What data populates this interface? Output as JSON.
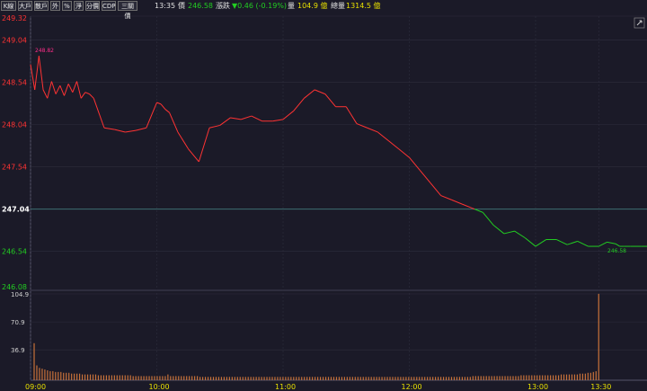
{
  "toolbar": {
    "buttons": [
      "K線",
      "大戶",
      "散戶",
      "外",
      "%",
      "淨",
      "分價",
      "CDP",
      "三關價"
    ],
    "time": "13:35",
    "price_label": "價",
    "price_value": "246.58",
    "change_label": "漲跌",
    "change_value": "▼0.46 (-0.19%)",
    "volume_label": "量",
    "volume_value": "104.9 億",
    "total_label": "總量",
    "total_value": "1314.5 億"
  },
  "colors": {
    "background": "#1b1a28",
    "up": "#ff3333",
    "down": "#22cc22",
    "reference": "#3c6e72",
    "volume": "#c8723a",
    "time_label": "#e8e000",
    "max_label": "#ff2d8a",
    "grid": "#2e2d3d"
  },
  "chart_data": [
    {
      "type": "line",
      "reference_price": 247.04,
      "ylim": [
        246.08,
        249.32
      ],
      "y_ticks": [
        "249.32",
        "249.04",
        "248.54",
        "248.04",
        "247.54",
        "247.04",
        "246.54",
        "246.08"
      ],
      "x_ticks": [
        "09:00",
        "10:00",
        "11:00",
        "12:00",
        "13:00",
        "13:30"
      ],
      "annotations": {
        "high": "248.82",
        "last": "246.58"
      },
      "x": [
        0,
        2,
        4,
        6,
        8,
        10,
        12,
        14,
        16,
        18,
        20,
        22,
        24,
        26,
        28,
        30,
        35,
        40,
        45,
        50,
        55,
        60,
        62,
        64,
        66,
        70,
        75,
        80,
        85,
        90,
        95,
        100,
        105,
        110,
        115,
        120,
        125,
        130,
        135,
        140,
        145,
        150,
        155,
        160,
        165,
        170,
        175,
        180,
        185,
        190,
        195,
        200,
        205,
        210,
        215,
        220,
        225,
        230,
        235,
        240,
        245,
        250,
        255,
        260,
        265,
        270,
        274,
        278,
        280,
        282,
        285,
        290,
        295,
        300,
        305,
        310,
        315,
        320,
        330
      ],
      "values": [
        248.75,
        248.45,
        248.85,
        248.45,
        248.35,
        248.55,
        248.4,
        248.5,
        248.38,
        248.52,
        248.42,
        248.55,
        248.35,
        248.42,
        248.4,
        248.35,
        248.0,
        247.98,
        247.95,
        247.97,
        248.0,
        248.3,
        248.28,
        248.22,
        248.18,
        247.95,
        247.75,
        247.6,
        248.0,
        248.03,
        248.12,
        248.1,
        248.14,
        248.08,
        248.08,
        248.1,
        248.2,
        248.35,
        248.45,
        248.4,
        248.25,
        248.25,
        248.05,
        248.0,
        247.95,
        247.85,
        247.75,
        247.65,
        247.5,
        247.35,
        247.2,
        247.15,
        247.1,
        247.05,
        247.0,
        246.85,
        246.75,
        246.78,
        246.7,
        246.6,
        246.68,
        246.68,
        246.62,
        246.66,
        246.6,
        246.6,
        246.65,
        246.63,
        246.6,
        246.6,
        246.6,
        246.6,
        246.6,
        246.6,
        246.6,
        246.6,
        246.6,
        246.6,
        246.58
      ]
    },
    {
      "type": "bar",
      "ylim": [
        0,
        104.9
      ],
      "y_ticks": [
        "104.9",
        "70.9",
        "36.9"
      ],
      "values": [
        45,
        18,
        15,
        14,
        13,
        12,
        11,
        11,
        10,
        10,
        10,
        9,
        9,
        9,
        8,
        8,
        8,
        8,
        7,
        7,
        7,
        7,
        7,
        7,
        6,
        6,
        6,
        6,
        6,
        6,
        6,
        6,
        6,
        6,
        6,
        6,
        6,
        5,
        5,
        5,
        5,
        5,
        5,
        5,
        5,
        5,
        5,
        5,
        5,
        5,
        7,
        5,
        5,
        5,
        5,
        5,
        5,
        5,
        5,
        5,
        5,
        5,
        4,
        4,
        4,
        4,
        4,
        4,
        4,
        4,
        4,
        4,
        4,
        4,
        4,
        4,
        4,
        4,
        4,
        4,
        4,
        4,
        4,
        4,
        4,
        4,
        4,
        4,
        4,
        4,
        4,
        4,
        4,
        4,
        4,
        4,
        4,
        4,
        4,
        4,
        4,
        4,
        4,
        4,
        4,
        4,
        4,
        4,
        4,
        4,
        4,
        4,
        4,
        4,
        4,
        4,
        4,
        4,
        4,
        4,
        4,
        4,
        4,
        4,
        4,
        4,
        4,
        4,
        4,
        4,
        4,
        4,
        4,
        4,
        4,
        4,
        4,
        4,
        4,
        4,
        4,
        4,
        4,
        4,
        4,
        4,
        4,
        4,
        4,
        4,
        4,
        4,
        4,
        4,
        4,
        4,
        4,
        4,
        4,
        4,
        4,
        4,
        4,
        4,
        5,
        5,
        5,
        5,
        5,
        5,
        5,
        5,
        5,
        5,
        5,
        5,
        5,
        5,
        5,
        5,
        5,
        5,
        6,
        6,
        6,
        6,
        6,
        6,
        6,
        6,
        6,
        6,
        6,
        6,
        6,
        6,
        6,
        7,
        7,
        7,
        7,
        7,
        7,
        7,
        8,
        8,
        8,
        9,
        9,
        10,
        11,
        105
      ]
    }
  ]
}
